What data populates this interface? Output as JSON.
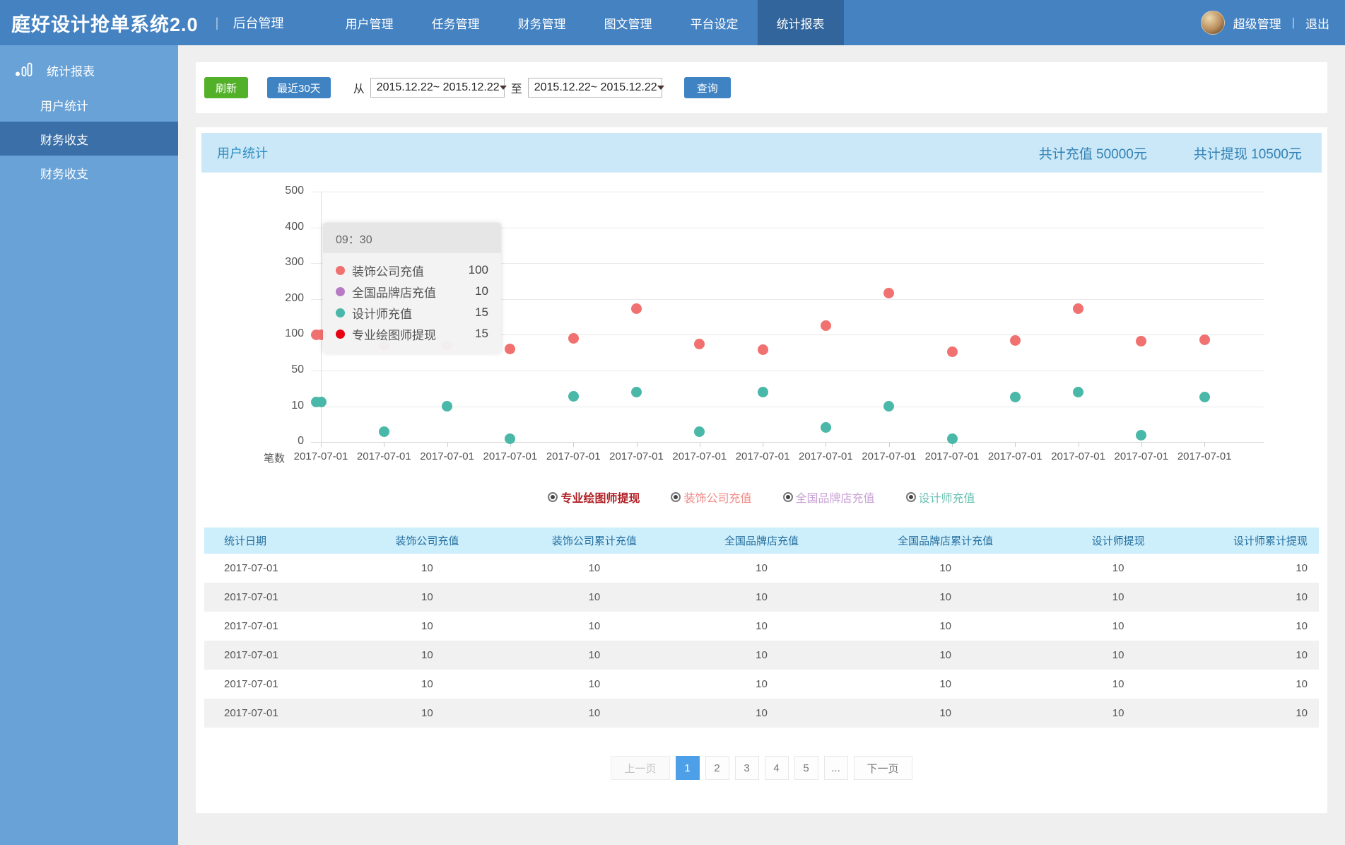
{
  "topnav": {
    "logo": "庭好设计抢单系统2.0",
    "separator": "丨",
    "subtitle": "后台管理",
    "items": [
      {
        "label": "用户管理",
        "active": false
      },
      {
        "label": "任务管理",
        "active": false
      },
      {
        "label": "财务管理",
        "active": false
      },
      {
        "label": "图文管理",
        "active": false
      },
      {
        "label": "平台设定",
        "active": false
      },
      {
        "label": "统计报表",
        "active": true
      }
    ],
    "user": {
      "name": "超级管理",
      "separator": "|",
      "logout": "退出"
    }
  },
  "sidebar": {
    "section": {
      "label": "统计报表",
      "icon": "bar-chart-icon"
    },
    "items": [
      {
        "label": "用户统计",
        "active": false
      },
      {
        "label": "财务收支",
        "active": true
      },
      {
        "label": "财务收支",
        "active": false
      }
    ]
  },
  "toolbar": {
    "refresh_label": "刷新",
    "last30_label": "最近30天",
    "from_label": "从",
    "from_value": "2015.12.22~ 2015.12.22",
    "to_label": "至",
    "to_value": "2015.12.22~ 2015.12.22",
    "query_label": "查询"
  },
  "panel": {
    "title": "用户统计",
    "total_recharge": "共计充值 50000元",
    "total_withdraw": "共计提现 10500元"
  },
  "chart_data": {
    "type": "scatter",
    "title": "用户统计",
    "grid": true,
    "y_ticks": [
      500,
      400,
      300,
      200,
      100,
      50,
      10,
      0
    ],
    "y_axis_note": "non-linear axis: ticks 0,10,50,100,200,300,400,500 evenly spaced",
    "x_axis_name": "笔数",
    "x_labels": [
      "2017-07-01",
      "2017-07-01",
      "2017-07-01",
      "2017-07-01",
      "2017-07-01",
      "2017-07-01",
      "2017-07-01",
      "2017-07-01",
      "2017-07-01",
      "2017-07-01",
      "2017-07-01",
      "2017-07-01",
      "2017-07-01",
      "2017-07-01",
      "2017-07-01"
    ],
    "series": [
      {
        "name": "装饰公司充值",
        "color": "#f0716f",
        "values": [
          100,
          85,
          85,
          80,
          95,
          172,
          87,
          79,
          125,
          216,
          76,
          92,
          173,
          91,
          93
        ]
      },
      {
        "name": "全国品牌店充值",
        "color": "#b77bc6",
        "values": [
          10,
          null,
          null,
          null,
          null,
          null,
          null,
          null,
          null,
          null,
          null,
          null,
          null,
          null,
          null
        ]
      },
      {
        "name": "设计师充值",
        "color": "#4ab8a8",
        "values": [
          15,
          3,
          10,
          1,
          21,
          26,
          3,
          26,
          4,
          10,
          1,
          20,
          26,
          2,
          20
        ]
      },
      {
        "name": "专业绘图师提现",
        "color": "#e60012",
        "values": [
          15,
          null,
          null,
          null,
          null,
          null,
          null,
          null,
          null,
          null,
          null,
          null,
          null,
          null,
          null
        ]
      }
    ],
    "visible_series": [
      "装饰公司充值",
      "设计师充值"
    ],
    "first_point_double": true,
    "tooltip": {
      "title": "09：30",
      "rows": [
        {
          "label": "装饰公司充值",
          "value": "100",
          "color": "#f0716f"
        },
        {
          "label": "全国品牌店充值",
          "value": "10",
          "color": "#b77bc6"
        },
        {
          "label": "设计师充值",
          "value": "15",
          "color": "#4ab8a8"
        },
        {
          "label": "专业绘图师提现",
          "value": "15",
          "color": "#e60012"
        }
      ]
    },
    "legend": [
      {
        "label": "专业绘图师提现",
        "color": "#b01f24",
        "emphasis": true
      },
      {
        "label": "装饰公司充值",
        "color": "#f08a88",
        "emphasis": false
      },
      {
        "label": "全国品牌店充值",
        "color": "#c9a2d6",
        "emphasis": false
      },
      {
        "label": "设计师充值",
        "color": "#67c0b2",
        "emphasis": false
      }
    ]
  },
  "table": {
    "headers": [
      "统计日期",
      "装饰公司充值",
      "装饰公司累计充值",
      "全国品牌店充值",
      "全国品牌店累计充值",
      "设计师提现",
      "设计师累计提现"
    ],
    "col_widths": [
      "13%",
      "14%",
      "16%",
      "14%",
      "19%",
      "12%",
      "12%"
    ],
    "rows": [
      [
        "2017-07-01",
        "10",
        "10",
        "10",
        "10",
        "10",
        "10"
      ],
      [
        "2017-07-01",
        "10",
        "10",
        "10",
        "10",
        "10",
        "10"
      ],
      [
        "2017-07-01",
        "10",
        "10",
        "10",
        "10",
        "10",
        "10"
      ],
      [
        "2017-07-01",
        "10",
        "10",
        "10",
        "10",
        "10",
        "10"
      ],
      [
        "2017-07-01",
        "10",
        "10",
        "10",
        "10",
        "10",
        "10"
      ],
      [
        "2017-07-01",
        "10",
        "10",
        "10",
        "10",
        "10",
        "10"
      ]
    ]
  },
  "pagination": {
    "prev": "上一页",
    "pages": [
      "1",
      "2",
      "3",
      "4",
      "5",
      "..."
    ],
    "active": "1",
    "next": "下一页"
  }
}
